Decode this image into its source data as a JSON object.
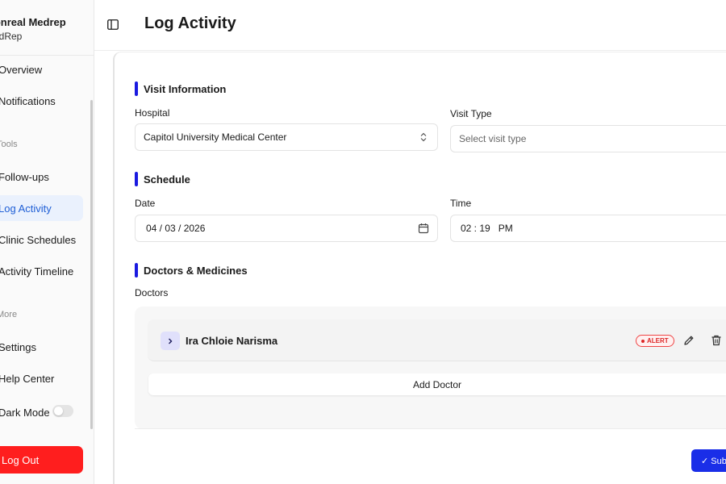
{
  "sidebar": {
    "brand_title": "Monreal Medrep",
    "brand_subtitle": "MedRep",
    "items": [
      {
        "label": "Overview"
      },
      {
        "label": "Notifications"
      },
      {
        "label": "Follow-ups"
      },
      {
        "label": "Log Activity"
      },
      {
        "label": "Clinic Schedules"
      },
      {
        "label": "Activity Timeline"
      },
      {
        "label": "Settings"
      },
      {
        "label": "Help Center"
      },
      {
        "label": "Dark Mode"
      }
    ],
    "sections": [
      "Tools",
      "More"
    ],
    "logout_label": "Log Out"
  },
  "header": {
    "title": "Log Activity"
  },
  "form": {
    "visit_section": "Visit Information",
    "hospital_label": "Hospital",
    "hospital_value": "Capitol University Medical Center",
    "visit_type_label": "Visit Type",
    "visit_type_placeholder": "Select visit type",
    "schedule_section": "Schedule",
    "date_label": "Date",
    "date_value": "04 / 03 / 2026",
    "time_label": "Time",
    "time_value": "02 : 19   PM",
    "doctors_section": "Doctors & Medicines",
    "doctors_label": "Doctors",
    "doctors": [
      {
        "name": "Ira Chloie Narisma",
        "badge": "ALERT"
      }
    ],
    "add_doctor_label": "Add Doctor",
    "submit_label": "✓ Submit"
  },
  "colors": {
    "accent": "#1a1ae0",
    "active_nav": "#1f5fd6",
    "logout": "#ff1e1e",
    "alert": "#dc2626",
    "submit": "#1a2ee8"
  }
}
